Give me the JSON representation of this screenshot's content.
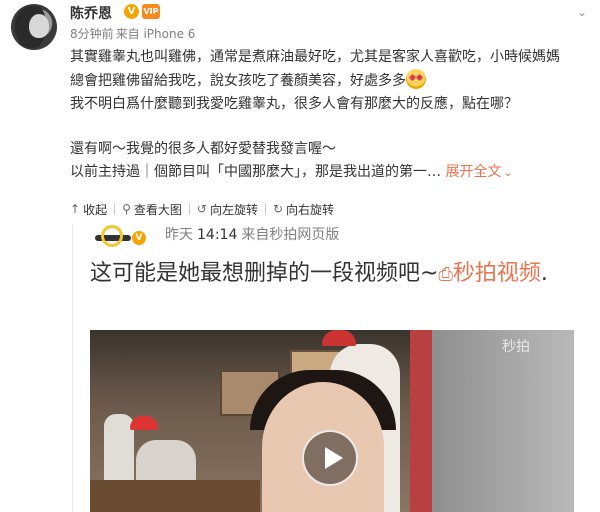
{
  "post": {
    "username": "陈乔恩",
    "verified_badge": "V",
    "vip_badge": "VIP",
    "time_ago": "8分钟前",
    "source": "来自 iPhone 6",
    "lines": [
      "其實雞睾丸也叫雞佛，通常是煮麻油最好吃，尤其是客家人喜歡吃，小時候媽媽",
      "總會把雞佛留給我吃，說女孩吃了養顏美容，好處多多",
      "我不明白爲什麼聽到我愛吃雞睾丸，很多人會有那麼大的反應，點在哪？",
      "還有啊～我覺的很多人都好愛替我發言喔～",
      "以前主持過｜個節目叫「中國那麼大」，那是我出道的第一…"
    ],
    "expand_label": "展开全文",
    "emoji": "heart-eyes-emoji"
  },
  "media_actions": {
    "collapse": "收起",
    "view_large": "查看大图",
    "rotate_left": "向左旋转",
    "rotate_right": "向右旋转"
  },
  "card": {
    "time": "昨天",
    "clock": "14:14",
    "source": "来自秒拍网页版",
    "title": "这可能是她最想删掉的一段视频吧~",
    "link_text": "秒拍视频",
    "title_end": "."
  },
  "video": {
    "watermark": "秒拍"
  },
  "colors": {
    "link": "#eb7350",
    "meta": "#808080",
    "text": "#333333",
    "badge": "#f7a400"
  }
}
